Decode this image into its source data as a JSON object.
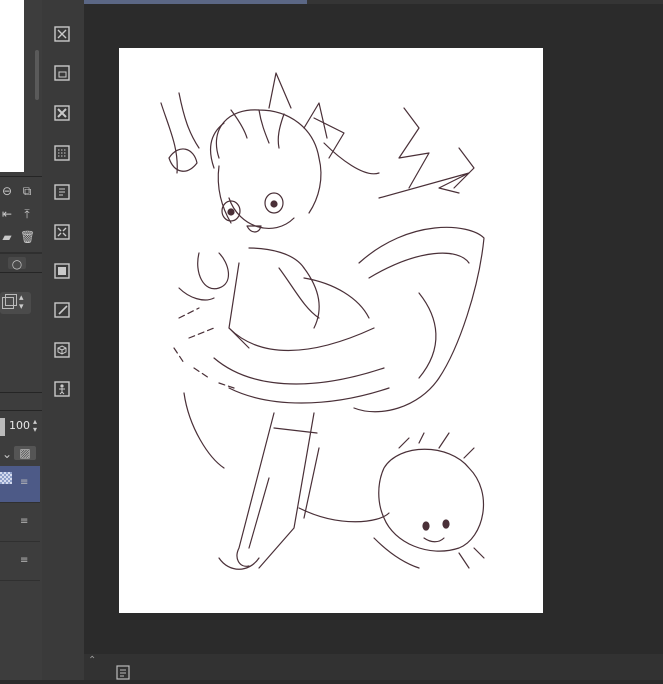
{
  "layer_panel": {
    "opacity_value": "100"
  },
  "icons": {
    "tool_column": [
      "layer-toggle-icon",
      "layer-ruler-icon",
      "layer-clear-icon",
      "layer-mask-icon",
      "layer-reference-icon",
      "layer-transform-icon",
      "layer-fill-icon",
      "layer-edit-icon",
      "layer-3d-icon",
      "layer-figure-icon"
    ],
    "controls": [
      "navigator-rotate-icon",
      "navigator-fit-icon",
      "flip-horizontal-icon",
      "flip-vertical-icon",
      "new-folder-icon",
      "delete-layer-icon"
    ]
  },
  "colors": {
    "sketch_line": "#4a3038",
    "selected_layer": "#4d5a87",
    "background": "#2b2b2b"
  }
}
